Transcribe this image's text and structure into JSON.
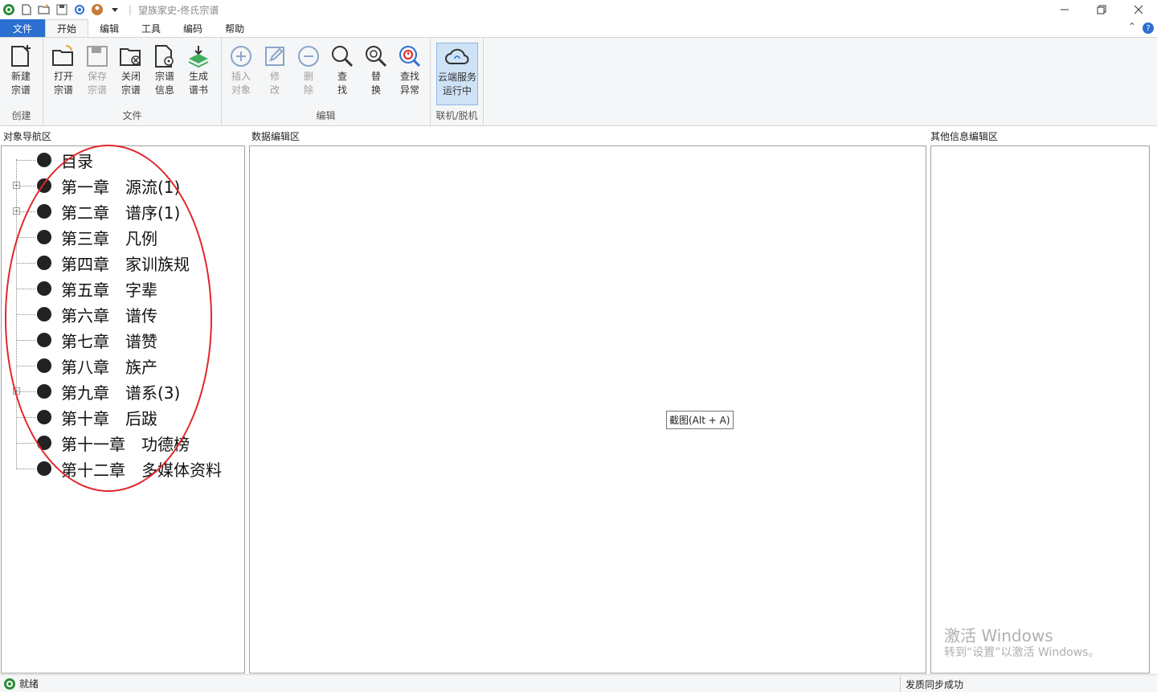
{
  "window": {
    "title": "望族家史-佟氏宗谱"
  },
  "menu": {
    "file": "文件",
    "tabs": [
      "开始",
      "编辑",
      "工具",
      "编码",
      "帮助"
    ]
  },
  "ribbon": {
    "groups": {
      "create": "创建",
      "file": "文件",
      "edit": "编辑",
      "online": "联机/脱机"
    },
    "buttons": {
      "new_tree": "新建\n宗谱",
      "open_tree": "打开\n宗谱",
      "save_tree": "保存\n宗谱",
      "close_tree": "关闭\n宗谱",
      "tree_info": "宗谱\n信息",
      "gen_book": "生成\n谱书",
      "insert_obj": "插入\n对象",
      "modify": "修\n改",
      "delete": "删\n除",
      "find": "查\n找",
      "replace": "替\n换",
      "find_error": "查找\n异常",
      "cloud": "云端服务\n运行中"
    }
  },
  "panels": {
    "nav_title": "对象导航区",
    "data_title": "数据编辑区",
    "other_title": "其他信息编辑区"
  },
  "tree": [
    {
      "chapter": "目录",
      "name": "",
      "expandable": false
    },
    {
      "chapter": "第一章",
      "name": "源流(1)",
      "expandable": true
    },
    {
      "chapter": "第二章",
      "name": "谱序(1)",
      "expandable": true
    },
    {
      "chapter": "第三章",
      "name": "凡例",
      "expandable": false
    },
    {
      "chapter": "第四章",
      "name": "家训族规",
      "expandable": false
    },
    {
      "chapter": "第五章",
      "name": "字辈",
      "expandable": false
    },
    {
      "chapter": "第六章",
      "name": "谱传",
      "expandable": false
    },
    {
      "chapter": "第七章",
      "name": "谱赞",
      "expandable": false
    },
    {
      "chapter": "第八章",
      "name": "族产",
      "expandable": false
    },
    {
      "chapter": "第九章",
      "name": "谱系(3)",
      "expandable": true
    },
    {
      "chapter": "第十章",
      "name": "后跋",
      "expandable": false
    },
    {
      "chapter": "第十一章",
      "name": "功德榜",
      "expandable": false
    },
    {
      "chapter": "第十二章",
      "name": "多媒体资料",
      "expandable": false
    }
  ],
  "tooltip": "截图(Alt + A)",
  "watermark": {
    "line1": "激活 Windows",
    "line2": "转到“设置”以激活 Windows。"
  },
  "status": {
    "left": "就绪",
    "right": "发质同步成功"
  },
  "colors": {
    "accent": "#2b6fd0",
    "annotation": "#e0262b",
    "cloud_highlight": "#cfe3f7"
  }
}
